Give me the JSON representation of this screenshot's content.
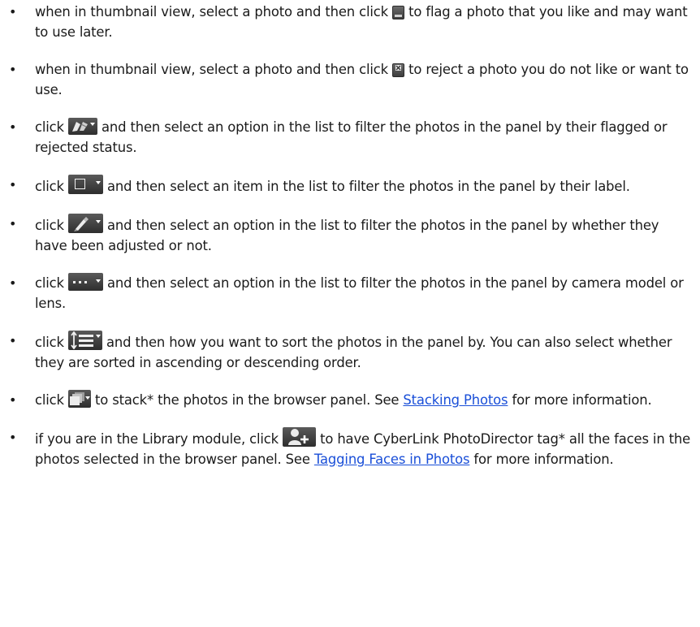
{
  "bullet": "•",
  "items": [
    {
      "icon": "flag-photo-icon",
      "before": "when in thumbnail view, select a photo and then click ",
      "after": " to flag a photo that you like and may want to use later."
    },
    {
      "icon": "reject-photo-icon",
      "before": "when in thumbnail view, select a photo and then click ",
      "after": " to reject a photo you do not like or want to use."
    },
    {
      "icon": "flag-filter-dropdown-icon",
      "before": "click ",
      "after": " and then select an option in the list to filter the photos in the panel by their flagged or rejected status."
    },
    {
      "icon": "label-filter-dropdown-icon",
      "before": "click ",
      "after": " and then select an item in the list to filter the photos in the panel by their label."
    },
    {
      "icon": "adjusted-filter-dropdown-icon",
      "before": "click ",
      "after": " and then select an option in the list to filter the photos in the panel by whether they have been adjusted or not."
    },
    {
      "icon": "camera-filter-dropdown-icon",
      "before": "click ",
      "after": " and then select an option in the list to filter the photos in the panel by camera model or lens."
    },
    {
      "icon": "sort-dropdown-icon",
      "before": "click ",
      "after": " and then how you want to sort the photos in the panel by. You can also select whether they are sorted in ascending or descending order."
    },
    {
      "icon": "stack-dropdown-icon",
      "before": "click ",
      "after": " to stack* the photos in the browser panel. See ",
      "link": "Stacking Photos",
      "tail": " for more information."
    },
    {
      "icon": "tag-faces-icon",
      "before": "if you are in the Library module, click ",
      "after": " to have CyberLink PhotoDirector tag* all the faces in the photos selected in the browser panel. See ",
      "link": "Tagging Faces in Photos",
      "tail": " for more information."
    }
  ]
}
